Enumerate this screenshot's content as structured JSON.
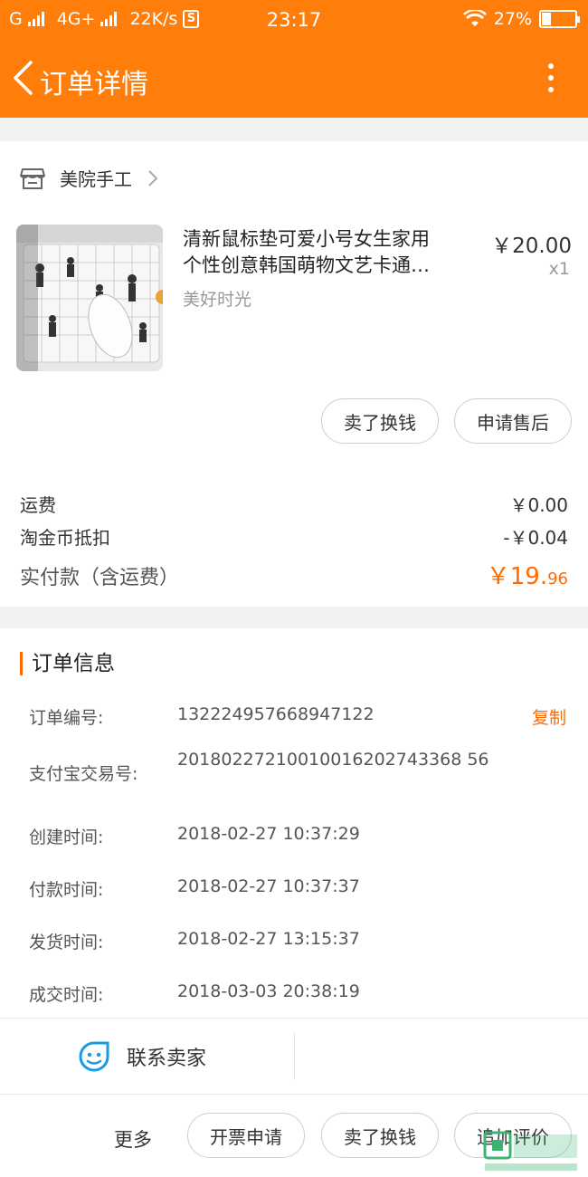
{
  "status_bar": {
    "carrier1": "G",
    "carrier2": "4G+",
    "speed": "22K/s",
    "s_badge": "S",
    "time": "23:17",
    "battery": "27%",
    "battery_level": 0.27
  },
  "header": {
    "title": "订单详情"
  },
  "shop": {
    "name": "美院手工"
  },
  "product": {
    "title_line1": "清新鼠标垫可爱小号女生家用",
    "title_line2": "个性创意韩国萌物文艺卡通…",
    "sku": "美好时光",
    "price": "￥20.00",
    "qty": "x1"
  },
  "item_actions": {
    "sell": "卖了换钱",
    "after_sale": "申请售后"
  },
  "summary": {
    "shipping_label": "运费",
    "shipping_value": "￥0.00",
    "coin_label": "淘金币抵扣",
    "coin_value": "-￥0.04",
    "total_label": "实付款（含运费）",
    "total_int": "￥19.",
    "total_dec": "96"
  },
  "order_info": {
    "heading": "订单信息",
    "order_no_label": "订单编号:",
    "order_no": "132224957668947122",
    "copy": "复制",
    "alipay_label": "支付宝交易号:",
    "alipay_no": "20180227210010016202743368 56",
    "created_label": "创建时间:",
    "created": "2018-02-27 10:37:29",
    "paid_label": "付款时间:",
    "paid": "2018-02-27 10:37:37",
    "shipped_label": "发货时间:",
    "shipped": "2018-02-27 13:15:37",
    "done_label": "成交时间:",
    "done": "2018-03-03 20:38:19"
  },
  "contact": {
    "label": "联系卖家"
  },
  "bottom_bar": {
    "more": "更多",
    "invoice": "开票申请",
    "sell": "卖了换钱",
    "review": "追加评价"
  },
  "colors": {
    "brand": "#ff7d0a",
    "accent": "#ff6a00"
  }
}
